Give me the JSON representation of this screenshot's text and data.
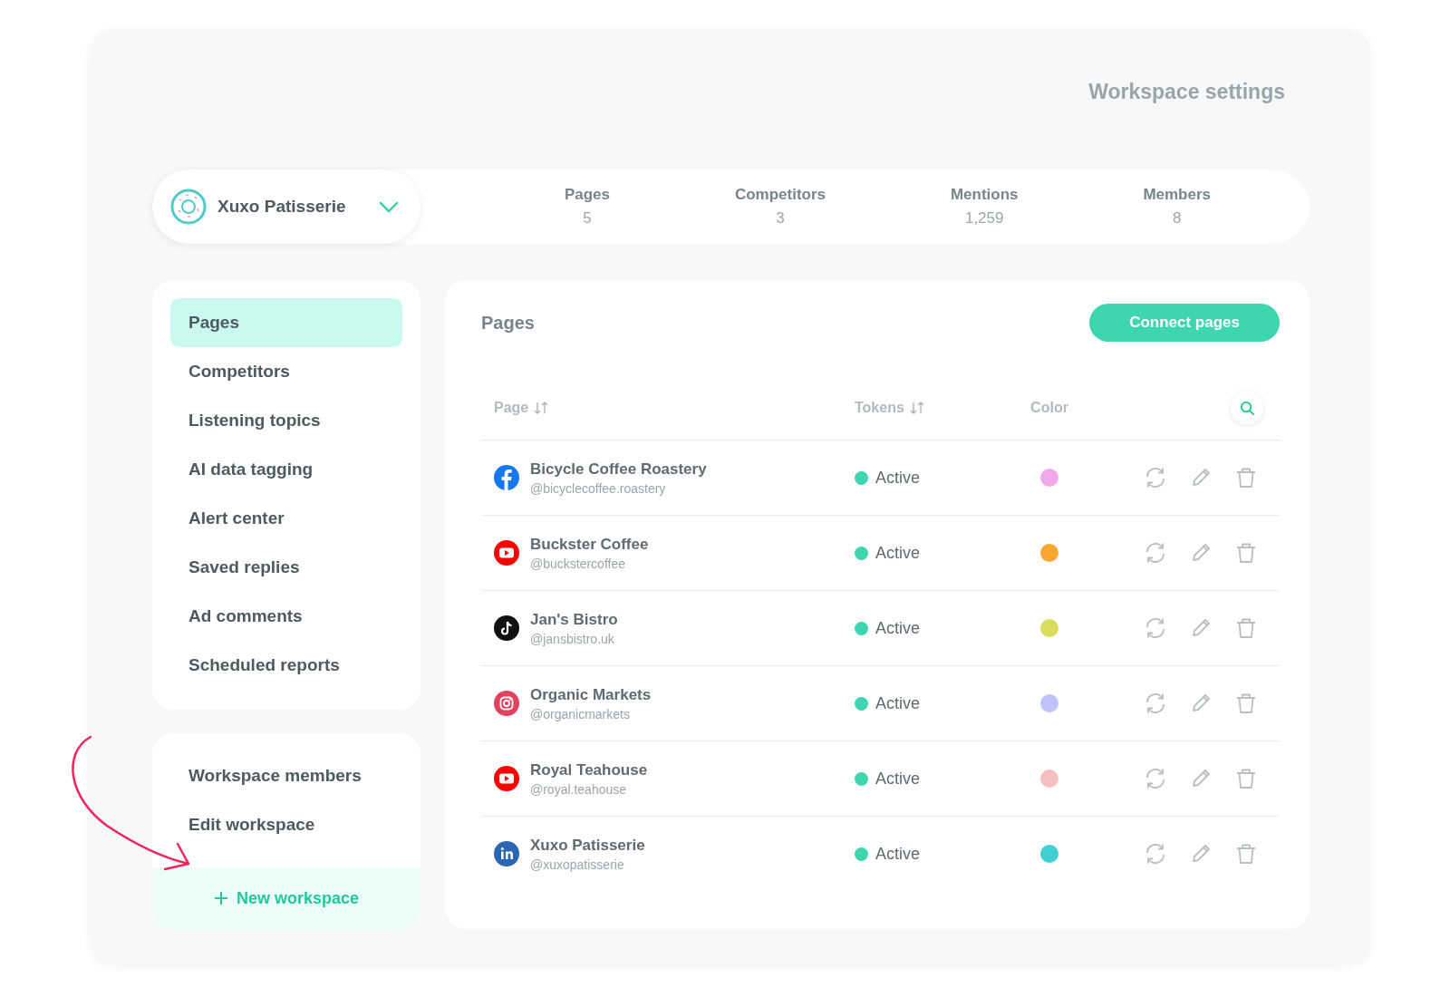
{
  "title": "Workspace settings",
  "workspace": {
    "name": "Xuxo Patisserie"
  },
  "stats": [
    {
      "label": "Pages",
      "value": "5"
    },
    {
      "label": "Competitors",
      "value": "3"
    },
    {
      "label": "Mentions",
      "value": "1,259"
    },
    {
      "label": "Members",
      "value": "8"
    }
  ],
  "sidebar": {
    "items": [
      {
        "label": "Pages",
        "selected": true
      },
      {
        "label": "Competitors",
        "selected": false
      },
      {
        "label": "Listening topics",
        "selected": false
      },
      {
        "label": "AI data tagging",
        "selected": false
      },
      {
        "label": "Alert center",
        "selected": false
      },
      {
        "label": "Saved replies",
        "selected": false
      },
      {
        "label": "Ad comments",
        "selected": false
      },
      {
        "label": "Scheduled reports",
        "selected": false
      }
    ],
    "secondary_items": [
      "Workspace members",
      "Edit workspace"
    ],
    "new_button": "New workspace"
  },
  "panel": {
    "title": "Pages",
    "button": "Connect pages",
    "columns": [
      "Page",
      "Tokens",
      "Color"
    ],
    "rows": [
      {
        "kind": "facebook",
        "name": "Bicycle Coffee Roastery",
        "handle": "@bicyclecoffee.roastery",
        "status": "Active",
        "color": "#f1a8ec"
      },
      {
        "kind": "youtube",
        "name": "Buckster Coffee",
        "handle": "@buckstercoffee",
        "status": "Active",
        "color": "#f9a731"
      },
      {
        "kind": "tiktok",
        "name": "Jan's Bistro",
        "handle": "@jansbistro.uk",
        "status": "Active",
        "color": "#d8dd5e"
      },
      {
        "kind": "instagram",
        "name": "Organic Markets",
        "handle": "@organicmarkets",
        "status": "Active",
        "color": "#c3c1fa"
      },
      {
        "kind": "youtube",
        "name": "Royal Teahouse",
        "handle": "@royal.teahouse",
        "status": "Active",
        "color": "#f7c0c0"
      },
      {
        "kind": "linkedin",
        "name": "Xuxo Patisserie",
        "handle": "@xuxopatisserie",
        "status": "Active",
        "color": "#3ed0d2"
      }
    ]
  }
}
